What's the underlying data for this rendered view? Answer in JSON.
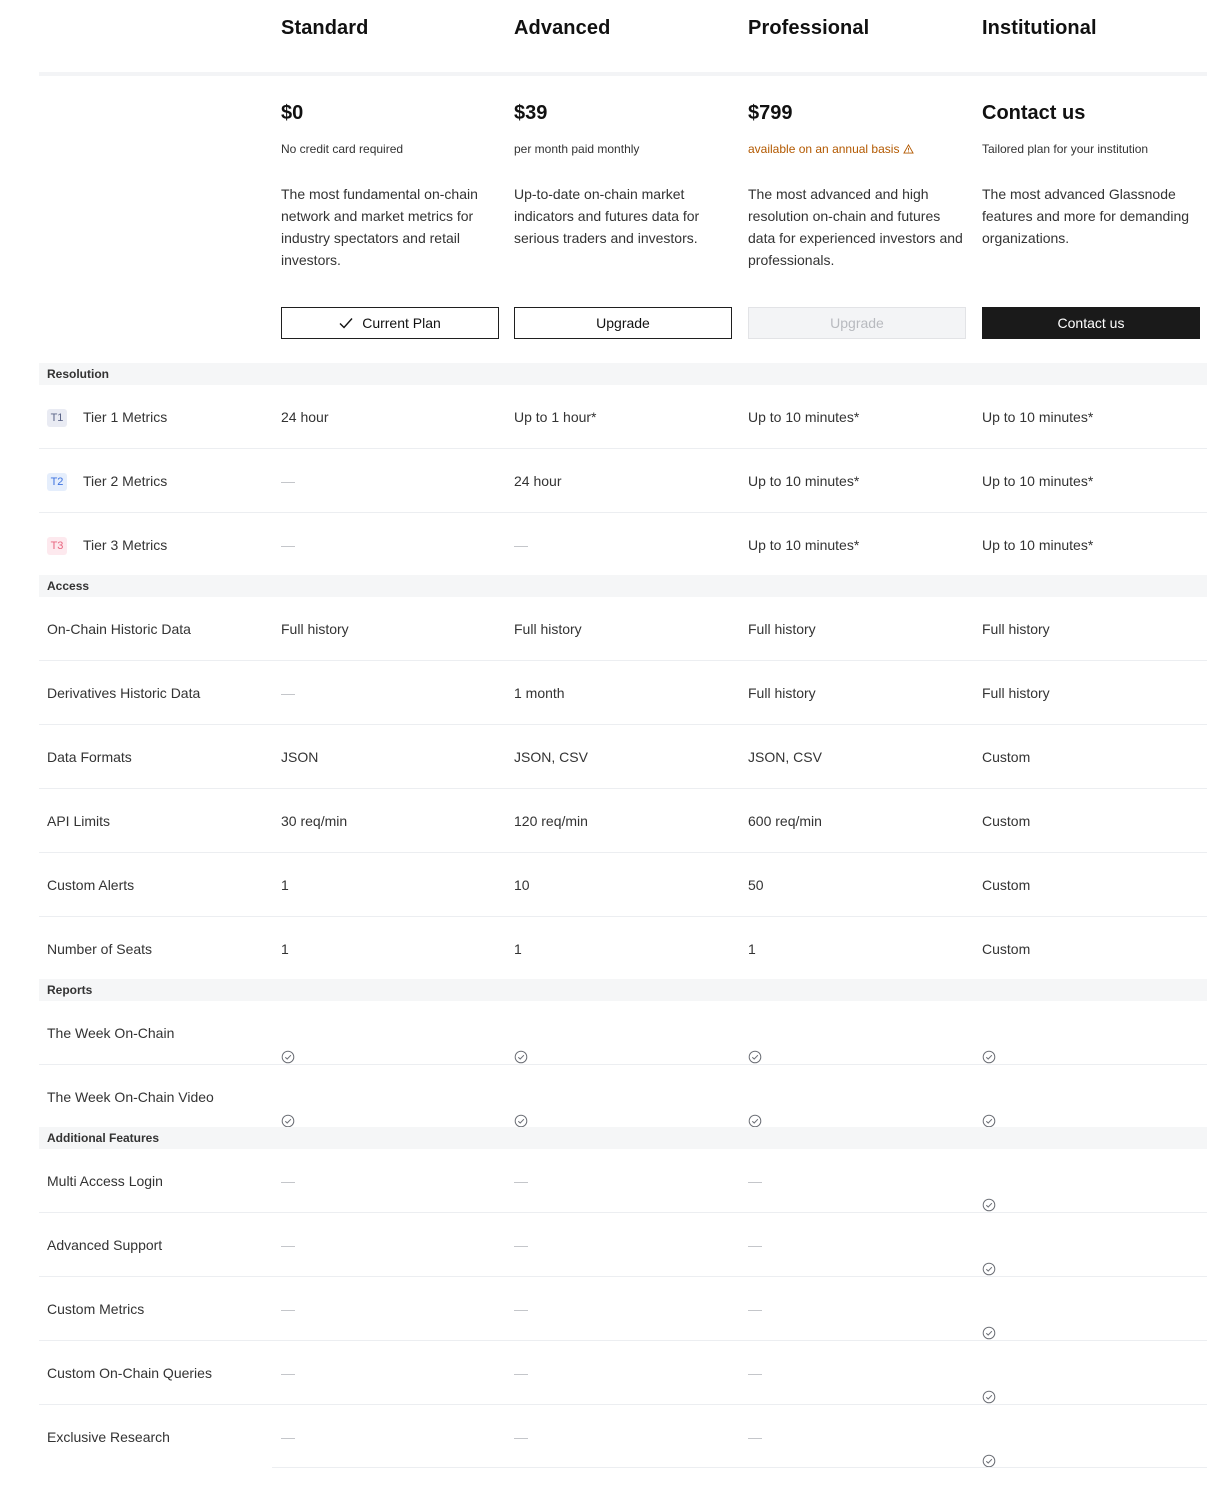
{
  "plans": [
    {
      "name": "Standard",
      "price": "$0",
      "subtitle": "No credit card required",
      "description": "The most fundamental on-chain network and market metrics for industry spectators and retail investors.",
      "button": "Current Plan"
    },
    {
      "name": "Advanced",
      "price": "$39",
      "subtitle": "per month paid monthly",
      "description": "Up-to-date on-chain market indicators and futures data for serious traders and investors.",
      "button": "Upgrade"
    },
    {
      "name": "Professional",
      "price": "$799",
      "subtitle": "available on an annual basis",
      "description": "The most advanced and high resolution on-chain and futures data for experienced investors and professionals.",
      "button": "Upgrade"
    },
    {
      "name": "Institutional",
      "price": "Contact us",
      "subtitle": "Tailored plan for your institution",
      "description": "The most advanced Glassnode features and more for demanding organizations.",
      "button": "Contact us"
    }
  ],
  "colors": {
    "warning": "#b35900",
    "dark_button": "#1a1a1a",
    "section_bg": "#f5f6f7"
  },
  "sections": [
    {
      "title": "Resolution",
      "rows": [
        {
          "badge": "T1",
          "label": "Tier 1 Metrics",
          "values": [
            "24 hour",
            "Up to 1 hour*",
            "Up to 10 minutes*",
            "Up to 10 minutes*"
          ]
        },
        {
          "badge": "T2",
          "label": "Tier 2 Metrics",
          "values": [
            "—",
            "24 hour",
            "Up to 10 minutes*",
            "Up to 10 minutes*"
          ]
        },
        {
          "badge": "T3",
          "label": "Tier 3 Metrics",
          "values": [
            "—",
            "—",
            "Up to 10 minutes*",
            "Up to 10 minutes*"
          ]
        }
      ]
    },
    {
      "title": "Access",
      "rows": [
        {
          "label": "On-Chain Historic Data",
          "values": [
            "Full history",
            "Full history",
            "Full history",
            "Full history"
          ]
        },
        {
          "label": "Derivatives Historic Data",
          "values": [
            "—",
            "1 month",
            "Full history",
            "Full history"
          ]
        },
        {
          "label": "Data Formats",
          "values": [
            "JSON",
            "JSON, CSV",
            "JSON, CSV",
            "Custom"
          ]
        },
        {
          "label": "API Limits",
          "values": [
            "30 req/min",
            "120 req/min",
            "600 req/min",
            "Custom"
          ]
        },
        {
          "label": "Custom Alerts",
          "values": [
            "1",
            "10",
            "50",
            "Custom"
          ]
        },
        {
          "label": "Number of Seats",
          "values": [
            "1",
            "1",
            "1",
            "Custom"
          ]
        }
      ]
    },
    {
      "title": "Reports",
      "rows": [
        {
          "label": "The Week On-Chain",
          "values": [
            "check",
            "check",
            "check",
            "check"
          ]
        },
        {
          "label": "The Week On-Chain Video",
          "values": [
            "check",
            "check",
            "check",
            "check"
          ]
        }
      ]
    },
    {
      "title": "Additional Features",
      "rows": [
        {
          "label": "Multi Access Login",
          "values": [
            "—",
            "—",
            "—",
            "check"
          ]
        },
        {
          "label": "Advanced Support",
          "values": [
            "—",
            "—",
            "—",
            "check"
          ]
        },
        {
          "label": "Custom Metrics",
          "values": [
            "—",
            "—",
            "—",
            "check"
          ]
        },
        {
          "label": "Custom On-Chain Queries",
          "values": [
            "—",
            "—",
            "—",
            "check"
          ]
        },
        {
          "label": "Exclusive Research",
          "values": [
            "—",
            "—",
            "—",
            "check"
          ]
        }
      ]
    }
  ]
}
